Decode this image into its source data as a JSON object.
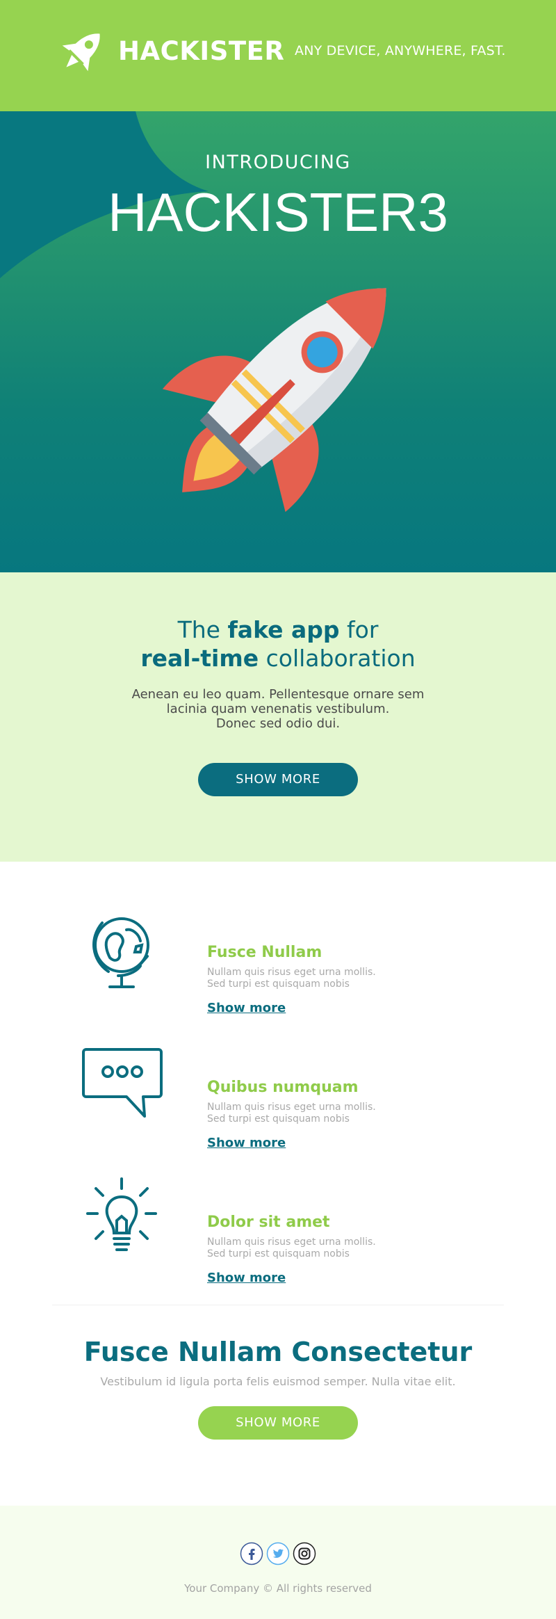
{
  "header": {
    "brand": "HACKISTER",
    "tagline": "ANY DEVICE, ANYWHERE, FAST."
  },
  "hero": {
    "intro": "INTRODUCING",
    "product": "HACKISTER3"
  },
  "intro_section": {
    "headline_pre": "The ",
    "headline_bold1": "fake app",
    "headline_mid": " for",
    "headline_bold2": "real-time",
    "headline_post": " collaboration",
    "body_line1": "Aenean eu leo quam. Pellentesque ornare sem",
    "body_line2": "lacinia quam venenatis vestibulum.",
    "body_line3": "Donec sed odio dui.",
    "button": "SHOW MORE"
  },
  "features": [
    {
      "icon": "globe-icon",
      "title": "Fusce Nullam",
      "text_line1": "Nullam quis risus eget urna mollis.",
      "text_line2": "Sed turpi est quisquam nobis",
      "link": "Show more"
    },
    {
      "icon": "chat-bubble-icon",
      "title": "Quibus numquam",
      "text_line1": "Nullam quis risus eget urna mollis.",
      "text_line2": "Sed turpi est quisquam nobis",
      "link": "Show more"
    },
    {
      "icon": "lightbulb-icon",
      "title": "Dolor sit amet",
      "text_line1": "Nullam quis risus eget urna mollis.",
      "text_line2": "Sed turpi est quisquam nobis",
      "link": "Show more"
    }
  ],
  "cta": {
    "title": "Fusce Nullam Consectetur",
    "text": "Vestibulum id ligula porta felis euismod semper. Nulla vitae elit.",
    "button": "SHOW MORE"
  },
  "footer": {
    "social": [
      "facebook-icon",
      "twitter-icon",
      "instagram-icon"
    ],
    "copyright": "Your Company © All rights reserved"
  },
  "colors": {
    "brand_green": "#96d350",
    "brand_teal": "#0b6d7f",
    "light_green_bg": "#e4f7d0",
    "footer_bg": "#f6fdee"
  }
}
